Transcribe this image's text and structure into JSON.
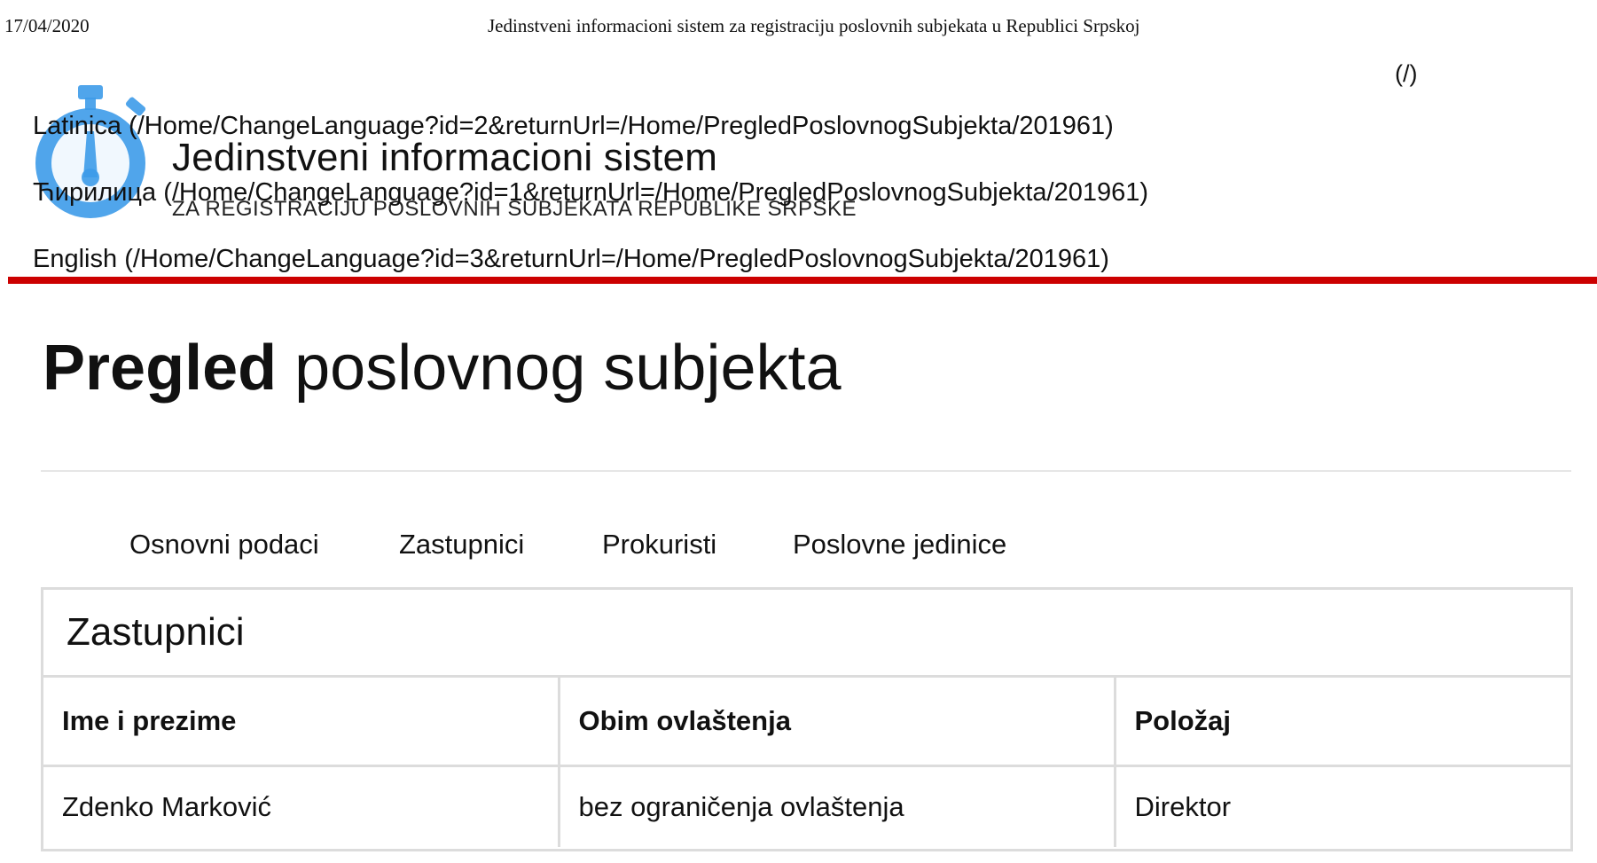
{
  "print_header": {
    "date": "17/04/2020",
    "title": "Jedinstveni informacioni sistem za registraciju poslovnih subjekata u Republici Srpskoj"
  },
  "home_link": "(/)",
  "brand": {
    "title": "Jedinstveni informacioni sistem",
    "subtitle": "ZA REGISTRACIJU POSLOVNIH SUBJEKATA REPUBLIKE SRPSKE",
    "logo_icon": "stopwatch-icon",
    "logo_color": "#3d9be9"
  },
  "languages": [
    {
      "label": "Latinica",
      "url": "(/Home/ChangeLanguage?id=2&returnUrl=/Home/PregledPoslovnogSubjekta/201961)"
    },
    {
      "label": "Ћирилица",
      "url": "(/Home/ChangeLanguage?id=1&returnUrl=/Home/PregledPoslovnogSubjekta/201961)"
    },
    {
      "label": "English",
      "url": "(/Home/ChangeLanguage?id=3&returnUrl=/Home/PregledPoslovnogSubjekta/201961)"
    }
  ],
  "accent_color": "#cc0000",
  "page_title": {
    "bold": "Pregled",
    "rest": "poslovnog subjekta"
  },
  "tabs": [
    {
      "label": "Osnovni podaci"
    },
    {
      "label": "Zastupnici"
    },
    {
      "label": "Prokuristi"
    },
    {
      "label": "Poslovne jedinice"
    }
  ],
  "panel": {
    "heading": "Zastupnici",
    "columns": [
      "Ime i prezime",
      "Obim ovlaštenja",
      "Položaj"
    ],
    "rows": [
      [
        "Zdenko Marković",
        "bez ograničenja ovlaštenja",
        "Direktor"
      ]
    ]
  }
}
